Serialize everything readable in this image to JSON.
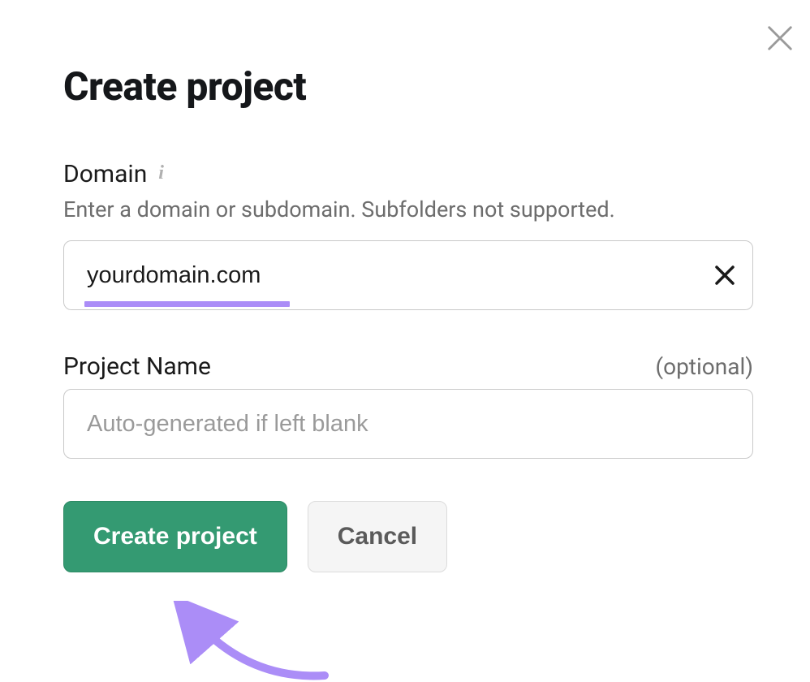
{
  "title": "Create project",
  "domain_field": {
    "label": "Domain",
    "help": "Enter a domain or subdomain. Subfolders not supported.",
    "value": "yourdomain.com"
  },
  "project_name_field": {
    "label": "Project Name",
    "optional": "(optional)",
    "placeholder": "Auto-generated if left blank"
  },
  "buttons": {
    "create": "Create project",
    "cancel": "Cancel"
  },
  "colors": {
    "accent_highlight": "#ab8df7",
    "primary_button": "#349a72"
  }
}
